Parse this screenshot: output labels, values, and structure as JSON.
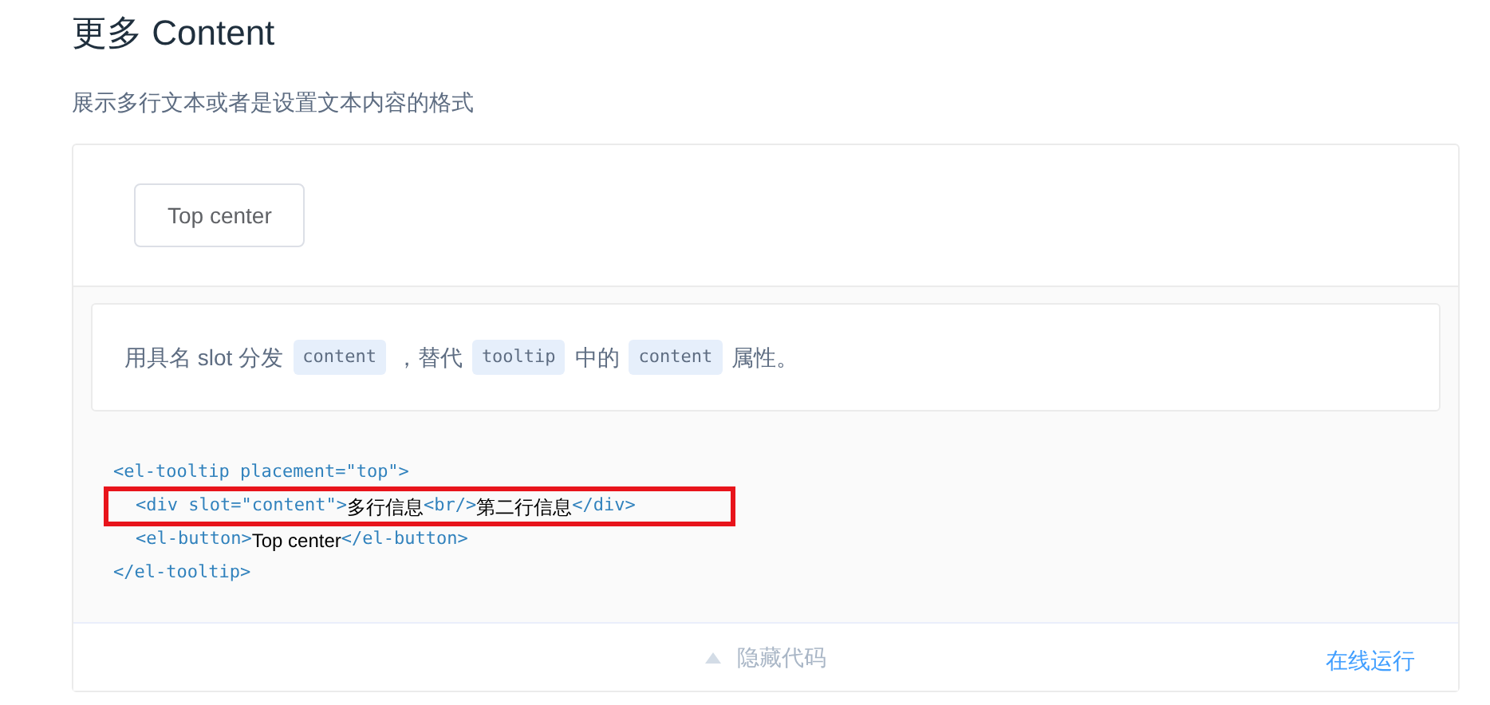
{
  "title": "更多 Content",
  "subtitle": "展示多行文本或者是设置文本内容的格式",
  "demo_button": "Top center",
  "description": [
    {
      "kind": "text",
      "text": "用具名 slot 分发"
    },
    {
      "kind": "code",
      "text": "content"
    },
    {
      "kind": "text",
      "text": "，替代"
    },
    {
      "kind": "code",
      "text": "tooltip"
    },
    {
      "kind": "text",
      "text": "中的"
    },
    {
      "kind": "code",
      "text": "content"
    },
    {
      "kind": "text",
      "text": "属性。"
    }
  ],
  "code_lines": [
    {
      "indent": false,
      "highlighted": false,
      "tokens": [
        {
          "kind": "tag",
          "text": "<el-tooltip placement=\"top\">"
        }
      ]
    },
    {
      "indent": true,
      "highlighted": true,
      "tokens": [
        {
          "kind": "tag",
          "text": "<div slot=\"content\">"
        },
        {
          "kind": "text",
          "text": "多行信息"
        },
        {
          "kind": "tag",
          "text": "<br/>"
        },
        {
          "kind": "text",
          "text": "第二行信息"
        },
        {
          "kind": "tag",
          "text": "</div>"
        }
      ]
    },
    {
      "indent": true,
      "highlighted": false,
      "tokens": [
        {
          "kind": "tag",
          "text": "<el-button>"
        },
        {
          "kind": "text",
          "text": "Top center"
        },
        {
          "kind": "tag",
          "text": "</el-button>"
        }
      ]
    },
    {
      "indent": false,
      "highlighted": false,
      "tokens": [
        {
          "kind": "tag",
          "text": "</el-tooltip>"
        }
      ]
    }
  ],
  "footer": {
    "toggle_label": "隐藏代码",
    "run_link": "在线运行"
  }
}
